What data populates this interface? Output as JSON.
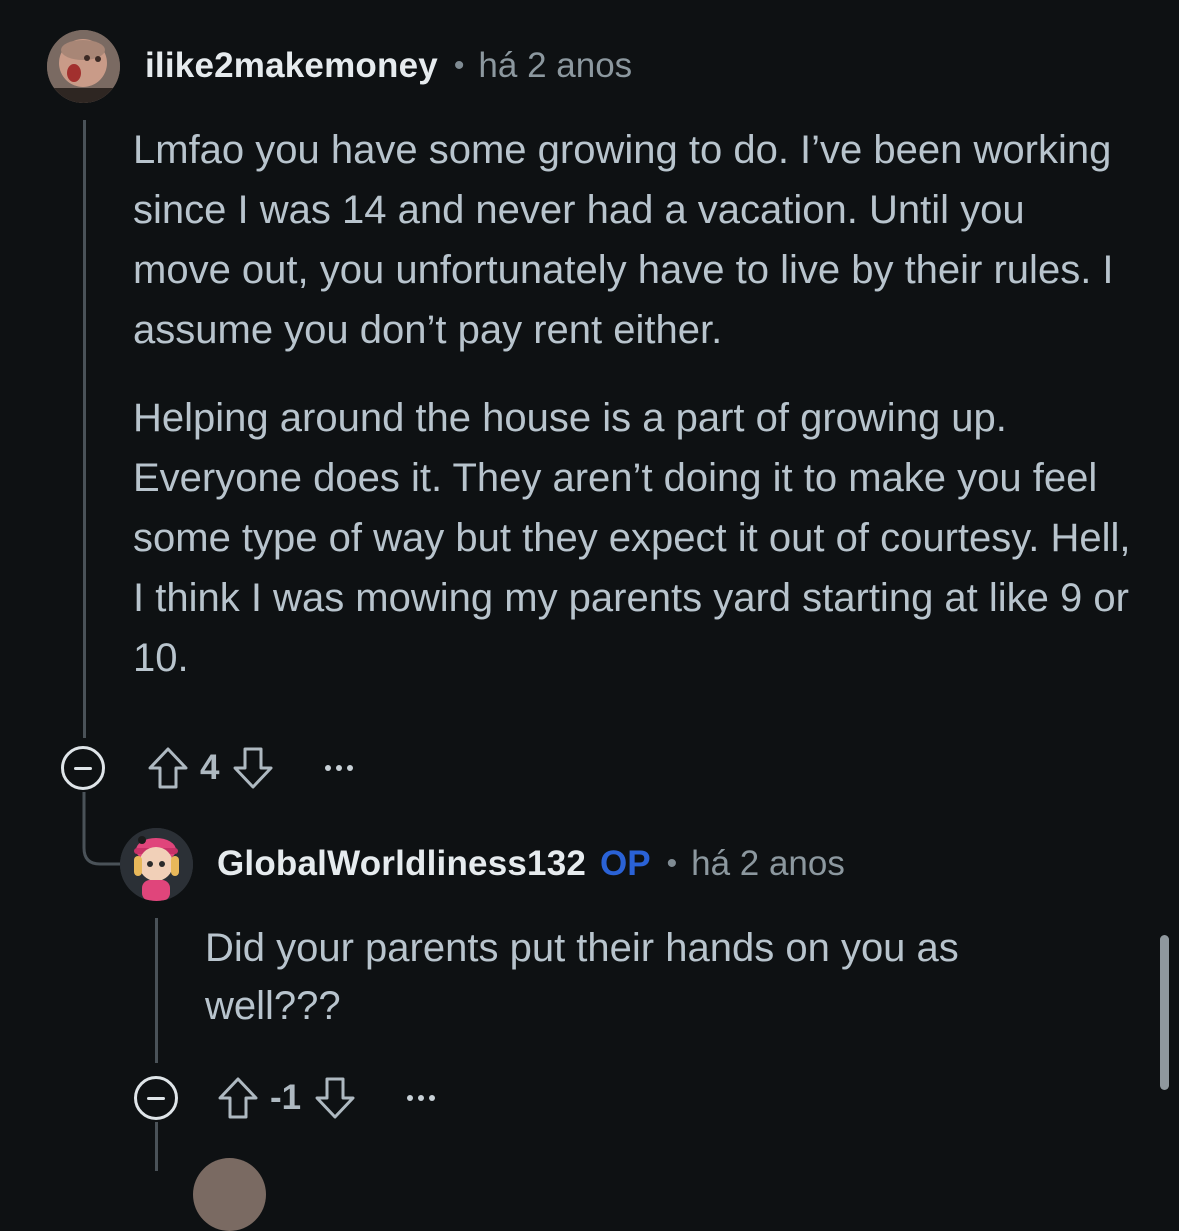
{
  "comments": [
    {
      "username": "ilike2makemoney",
      "time": "há 2 anos",
      "avatar_icon": "user-avatar-photo",
      "paragraphs": [
        "Lmfao you have some growing to do. I’ve been working since I was 14 and never had a vacation. Until you move out, you unfortunately have to live by their rules. I assume you don’t pay rent either.",
        "Helping around the house is a part of growing up. Everyone does it. They aren’t doing it to make you feel some type of way but they expect it out of courtesy. Hell, I think I was mowing my parents yard starting at like 9 or 10."
      ],
      "score": "4"
    },
    {
      "username": "GlobalWorldliness132",
      "op_badge": "OP",
      "time": "há 2 anos",
      "avatar_icon": "snoo-avatar",
      "paragraphs": [
        "Did your parents put their hands on you as well???"
      ],
      "score": "-1"
    }
  ],
  "separator": "•",
  "colors": {
    "background": "#0e1113",
    "username": "#e6ebee",
    "op": "#2a62d6",
    "body": "#b8c4cd",
    "meta": "#8c989f"
  }
}
